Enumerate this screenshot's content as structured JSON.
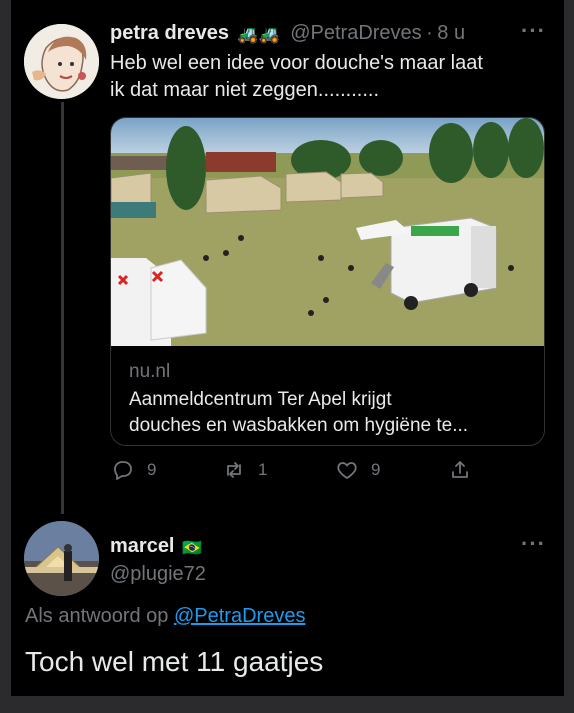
{
  "tweet": {
    "author_name": "petra dreves",
    "author_emoji": "🚜🚜",
    "handle": "@PetraDreves",
    "separator": "·",
    "time": "8 u",
    "text_line1": "Heb wel een idee voor douche's maar laat",
    "text_line2": "ik dat maar niet zeggen...........",
    "more_icon": "more-icon",
    "card": {
      "domain": "nu.nl",
      "title_line1": "Aanmeldcentrum Ter Apel krijgt",
      "title_line2": "douches en wasbakken om hygiëne te..."
    },
    "actions": {
      "replies": "9",
      "retweets": "1",
      "likes": "9"
    }
  },
  "reply": {
    "author_name": "marcel",
    "author_flag": "🇧🇷",
    "handle": "@plugie72",
    "reply_to_label": "Als antwoord op",
    "reply_to_handle": "@PetraDreves",
    "text": "Toch wel met 11 gaatjes"
  },
  "colors": {
    "background": "#000000",
    "text": "#e7e9ea",
    "muted": "#71767b",
    "link": "#1d9bf0",
    "border": "#2f3336"
  }
}
